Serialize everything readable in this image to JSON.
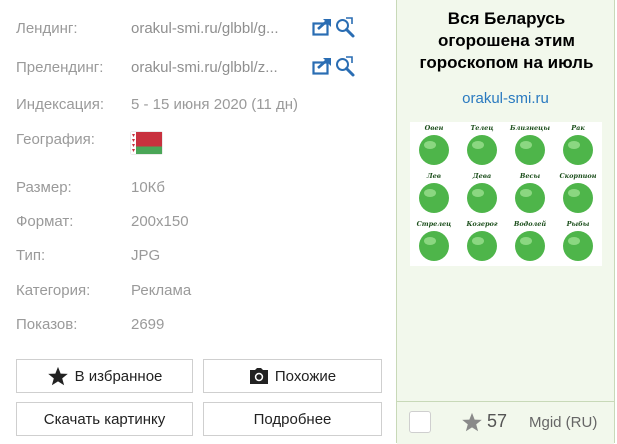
{
  "details": {
    "landing": {
      "key": "Лендинг:",
      "value": "orakul-smi.ru/glbbl/g..."
    },
    "prelanding": {
      "key": "Прелендинг:",
      "value": "orakul-smi.ru/glbbl/z..."
    },
    "indexing": {
      "key": "Индексация:",
      "value": "5 - 15 июня 2020 (11 дн)"
    },
    "geo": {
      "key": "География:",
      "flag": "belarus-flag"
    },
    "size": {
      "key": "Размер:",
      "value": "10Кб"
    },
    "format": {
      "key": "Формат:",
      "value": "200x150"
    },
    "type": {
      "key": "Тип:",
      "value": "JPG"
    },
    "category": {
      "key": "Категория:",
      "value": "Реклама"
    },
    "views": {
      "key": "Показов:",
      "value": "2699"
    }
  },
  "actions": {
    "favorite_label": "В избранное",
    "similar_label": "Похожие",
    "download_label": "Скачать картинку",
    "more_label": "Подробнее"
  },
  "ad": {
    "title": "Вся Беларусь огорошена этим гороскопом на июль",
    "domain": "orakul-smi.ru",
    "zodiac_labels": [
      "Овен",
      "Телец",
      "Близнецы",
      "Рак",
      "Лев",
      "Дева",
      "Весы",
      "Скорпион",
      "Стрелец",
      "Козерог",
      "Водолей",
      "Рыбы"
    ],
    "rating": "57",
    "network": "Mgid (RU)"
  },
  "colors": {
    "ad_background": "#f2f8ec",
    "link_blue": "#2a7ac0",
    "zodiac_green": "#2fa82a"
  }
}
